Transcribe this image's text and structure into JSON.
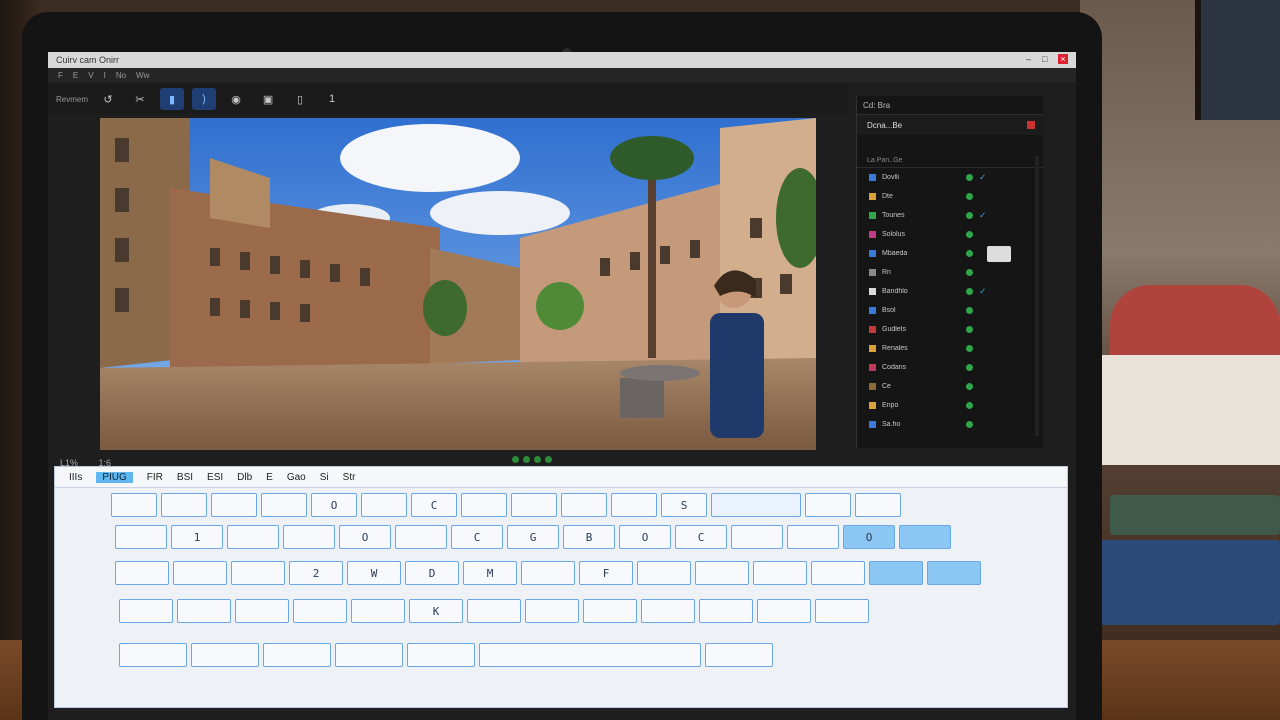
{
  "window": {
    "title": "Cuirv cam Onirr",
    "menu": [
      "F",
      "E",
      "V",
      "I",
      "No",
      "Ww"
    ]
  },
  "toolbar": {
    "label": "Revmem",
    "tools": [
      "undo-icon",
      "crop-icon",
      "select-icon",
      "brush-icon",
      "mask-icon",
      "stamp-icon",
      "frame-icon",
      "text-icon"
    ]
  },
  "viewer": {
    "coords": [
      "L1%",
      "1:6"
    ]
  },
  "panel": {
    "header": "Cd: Bra",
    "subheader": "Dcna...Be",
    "filter": "La Pan..Ge",
    "layers": [
      {
        "label": "Dovlli",
        "color": "#3a7ad9",
        "check": "✓"
      },
      {
        "label": "Dte",
        "color": "#d9a23a",
        "check": ""
      },
      {
        "label": "Tounes",
        "color": "#2ea64a",
        "check": "✓"
      },
      {
        "label": "Sololus",
        "color": "#c23a8a",
        "check": ""
      },
      {
        "label": "Mbaeda",
        "color": "#3a7ad9",
        "check": ""
      },
      {
        "label": "Rn",
        "color": "#8a8a8a",
        "check": ""
      },
      {
        "label": "Bandhlo",
        "color": "#d9d9d9",
        "check": "✓"
      },
      {
        "label": "Bsol",
        "color": "#3a7ad9",
        "check": ""
      },
      {
        "label": "Gudlets",
        "color": "#c23a3a",
        "check": ""
      },
      {
        "label": "Renales",
        "color": "#d9a23a",
        "check": ""
      },
      {
        "label": "Codans",
        "color": "#c23a5a",
        "check": ""
      },
      {
        "label": "Ce",
        "color": "#8a6a3a",
        "check": ""
      },
      {
        "label": "Enpo",
        "color": "#d9a23a",
        "check": ""
      },
      {
        "label": "Sa.ho",
        "color": "#3a7ad9",
        "check": ""
      }
    ]
  },
  "keyboard": {
    "toolbar": [
      "IIIs",
      "PIUG",
      "FIR",
      "BSI",
      "ESI",
      "Dlb",
      "E",
      "Gao",
      "Si",
      "Str"
    ],
    "row1": [
      "",
      "",
      "",
      "",
      "O",
      "",
      "C",
      "",
      "",
      "",
      "",
      "S",
      "",
      "",
      ""
    ],
    "row2": [
      "",
      "1",
      "",
      "",
      "O",
      "",
      "C",
      "G",
      "B",
      "O",
      "C",
      "",
      "",
      "O",
      ""
    ],
    "row3": [
      "",
      "",
      "",
      "2",
      "W",
      "D",
      "M",
      "",
      "F",
      "",
      "",
      "",
      "",
      "",
      ""
    ],
    "row4": [
      "",
      "",
      "",
      "",
      "",
      "K",
      "",
      "",
      "",
      "",
      "",
      "",
      ""
    ],
    "row5": [
      "",
      "",
      "",
      "",
      "",
      "",
      ""
    ]
  }
}
